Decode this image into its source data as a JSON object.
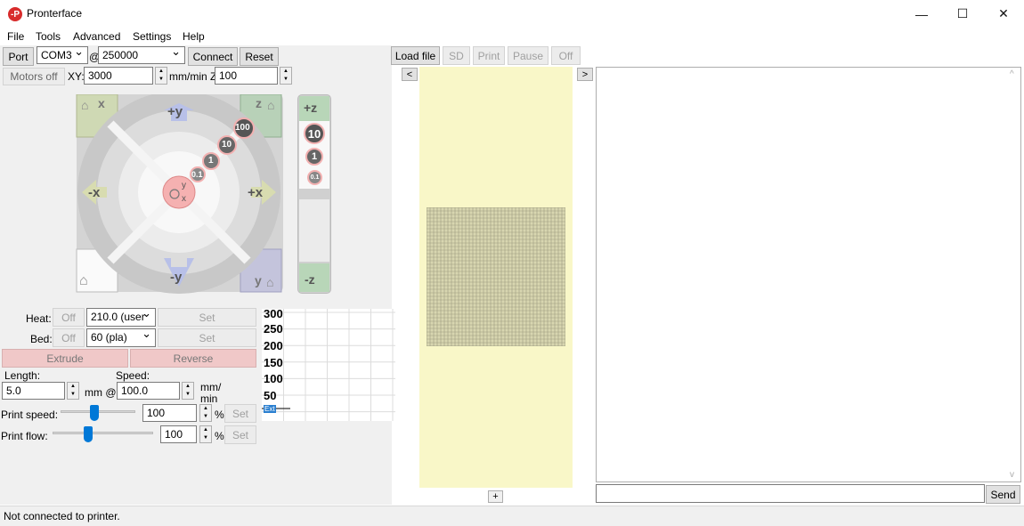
{
  "window": {
    "title": "Pronterface",
    "icon_text": "-P",
    "minimize": "—",
    "maximize": "☐",
    "close": "✕"
  },
  "menu": [
    "File",
    "Tools",
    "Advanced",
    "Settings",
    "Help"
  ],
  "toolbar": {
    "port_label": "Port",
    "port_value": "COM3",
    "at": "@",
    "baud_value": "250000",
    "connect_label": "Connect",
    "reset_label": "Reset",
    "motors_off_label": "Motors off",
    "xy_label": "XY:",
    "xy_value": "3000",
    "mmmin_z_label": "mm/min Z:",
    "z_value": "100"
  },
  "file_controls": {
    "load_file": "Load file",
    "sd": "SD",
    "print": "Print",
    "pause": "Pause",
    "off": "Off"
  },
  "jog": {
    "home_x": "x",
    "plus_y": "+y",
    "home_z": "z",
    "minus_x": "-x",
    "plus_x": "+x",
    "minus_y": "-y",
    "home_y": "y",
    "center_y": "y",
    "center_x": "x",
    "steps": [
      "100",
      "10",
      "1",
      "0.1"
    ],
    "z_plus": "+z",
    "z_minus": "-z",
    "z_steps": [
      "10",
      "1",
      "0.1"
    ]
  },
  "temps": {
    "heat_label": "Heat:",
    "heat_off": "Off",
    "heat_value": "210.0 (user",
    "bed_label": "Bed:",
    "bed_off": "Off",
    "bed_value": "60 (pla)",
    "set_label": "Set"
  },
  "extrude": {
    "extrude_label": "Extrude",
    "reverse_label": "Reverse",
    "length_label": "Length:",
    "length_value": "5.0",
    "mm_at": "mm @",
    "speed_label": "Speed:",
    "speed_value": "100.0",
    "mm": "mm/",
    "min": "min"
  },
  "print_speed": {
    "label": "Print speed:",
    "value": "100",
    "percent": "%",
    "set": "Set",
    "level": 0.45
  },
  "print_flow": {
    "label": "Print flow:",
    "value": "100",
    "percent": "%",
    "set": "Set",
    "level": 0.35
  },
  "temp_graph": {
    "y_ticks": [
      "300",
      "250",
      "200",
      "150",
      "100",
      "50"
    ],
    "tiny_label": "Ext"
  },
  "viewer": {
    "prev": "<",
    "next": ">",
    "add": "+"
  },
  "console": {
    "send_label": "Send",
    "scroll_up": "^",
    "scroll_down": "v"
  },
  "status": {
    "text": "Not connected to printer."
  },
  "colors": {
    "accent": "#0078d7",
    "viewer_bg": "#f9f7c8",
    "bed_grid": "#c8c8a0",
    "red_button": "#f3b3b3"
  }
}
